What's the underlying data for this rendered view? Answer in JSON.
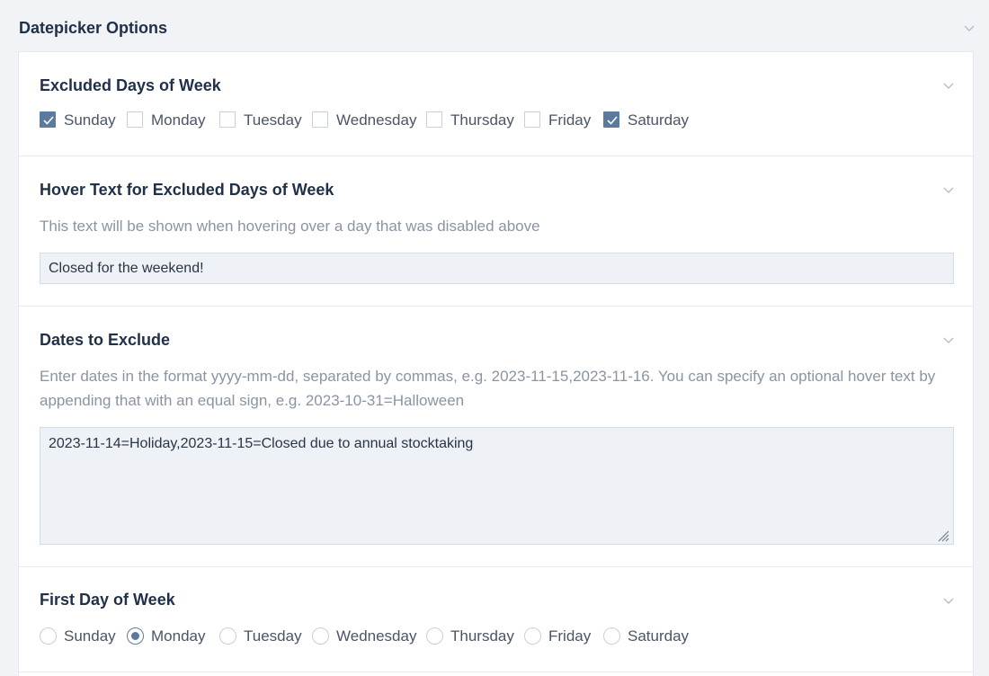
{
  "outer": {
    "title": "Datepicker Options",
    "chevron_icon": "chevron-down-icon"
  },
  "excluded_days": {
    "title": "Excluded Days of Week",
    "chevron_icon": "chevron-down-icon",
    "options": [
      {
        "label": "Sunday",
        "checked": true
      },
      {
        "label": "Monday",
        "checked": false
      },
      {
        "label": "Tuesday",
        "checked": false
      },
      {
        "label": "Wednesday",
        "checked": false
      },
      {
        "label": "Thursday",
        "checked": false
      },
      {
        "label": "Friday",
        "checked": false
      },
      {
        "label": "Saturday",
        "checked": true
      }
    ]
  },
  "hover_text": {
    "title": "Hover Text for Excluded Days of Week",
    "chevron_icon": "chevron-down-icon",
    "description": "This text will be shown when hovering over a day that was disabled above",
    "value": "Closed for the weekend!"
  },
  "dates_exclude": {
    "title": "Dates to Exclude",
    "chevron_icon": "chevron-down-icon",
    "description": "Enter dates in the format yyyy-mm-dd, separated by commas, e.g. 2023-11-15,2023-11-16. You can specify an optional hover text by appending that with an equal sign, e.g. 2023-10-31=Halloween",
    "value": "2023-11-14=Holiday,2023-11-15=Closed due to annual stocktaking"
  },
  "first_day": {
    "title": "First Day of Week",
    "chevron_icon": "chevron-down-icon",
    "options": [
      {
        "label": "Sunday",
        "checked": false
      },
      {
        "label": "Monday",
        "checked": true
      },
      {
        "label": "Tuesday",
        "checked": false
      },
      {
        "label": "Wednesday",
        "checked": false
      },
      {
        "label": "Thursday",
        "checked": false
      },
      {
        "label": "Friday",
        "checked": false
      },
      {
        "label": "Saturday",
        "checked": false
      }
    ]
  },
  "colors": {
    "accent": "#5c7a9e",
    "heading": "#1f3048",
    "muted": "#8a94a3",
    "input_bg": "#eef1f6"
  }
}
